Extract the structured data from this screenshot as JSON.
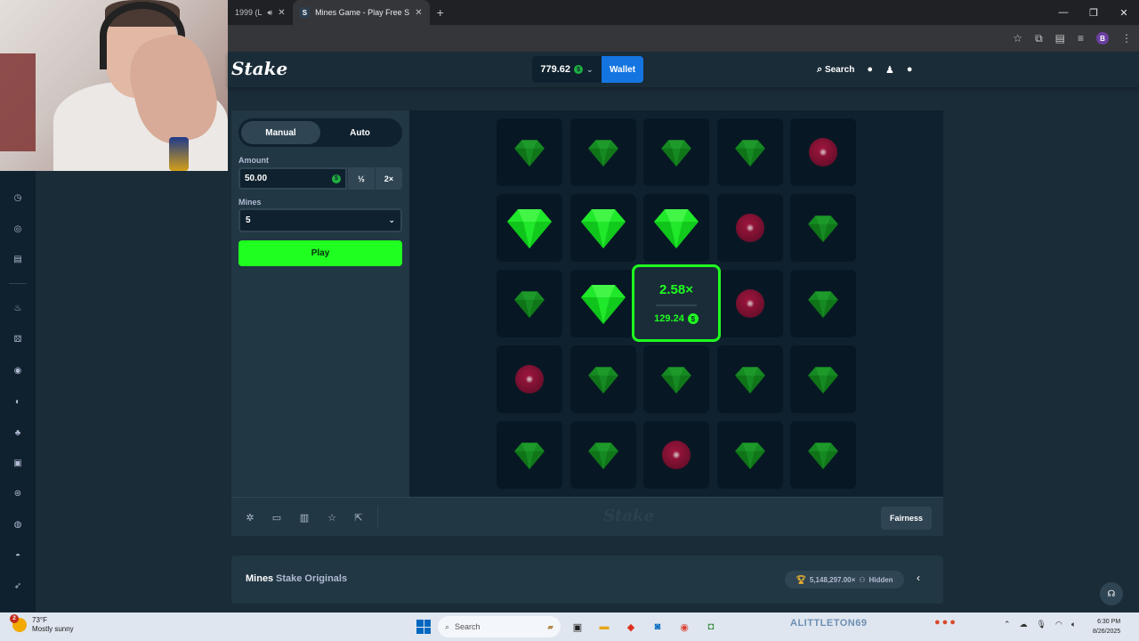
{
  "browser": {
    "tab1_title": "1999 (L",
    "tab2_title": "Mines Game - Play Free Social",
    "tab2_favicon": "S",
    "new_tab": "+",
    "profile_initial": "B"
  },
  "header": {
    "logo": "Stake",
    "balance": "779.62",
    "coin_symbol": "$",
    "wallet_label": "Wallet",
    "search_label": "Search"
  },
  "controls": {
    "mode_manual": "Manual",
    "mode_auto": "Auto",
    "amount_label": "Amount",
    "amount_value": "50.00",
    "half_label": "½",
    "double_label": "2×",
    "mines_label": "Mines",
    "mines_value": "5",
    "play_label": "Play"
  },
  "board": {
    "tiles": [
      "gem-small",
      "gem-small",
      "gem-small",
      "gem-small",
      "mine",
      "gem-big",
      "gem-big",
      "gem-big",
      "mine",
      "gem-small",
      "gem-small",
      "gem-big",
      "win-card",
      "mine",
      "gem-small",
      "mine",
      "gem-small",
      "gem-small",
      "gem-small",
      "gem-small",
      "gem-small",
      "gem-small",
      "mine",
      "gem-small",
      "gem-small"
    ],
    "win_multiplier": "2.58×",
    "win_amount": "129.24"
  },
  "footer": {
    "watermark": "Stake",
    "fairness_label": "Fairness"
  },
  "info": {
    "game_name": "Mines",
    "provider": "Stake Originals",
    "record": "5,148,297.00×",
    "hidden_label": "Hidden"
  },
  "taskbar": {
    "weather_badge": "2",
    "temperature": "73°F",
    "condition": "Mostly sunny",
    "search_label": "Search",
    "username": "ALITTLETON69",
    "time": "6:30 PM",
    "date": "8/26/2025"
  },
  "colors": {
    "accent_green": "#1fff20",
    "brand_blue": "#1475e1",
    "background": "#1a2c38",
    "panel": "#213743",
    "mine_red": "#a0163e"
  }
}
